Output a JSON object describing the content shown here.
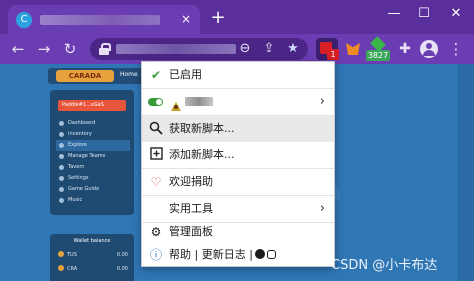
{
  "browser": {
    "tab": {
      "favicon": "C",
      "close": "×"
    },
    "new_tab": "+",
    "window_controls": {
      "minimize": "—",
      "maximize": "☐",
      "close": "✕"
    },
    "nav": {
      "back": "←",
      "forward": "→",
      "reload": "↻"
    },
    "address_icons": {
      "zoom": "⊖",
      "share": "⇪",
      "star": "★"
    },
    "extensions": {
      "tampermonkey_badge": "1",
      "gem_count": "3827",
      "puzzle": "✚"
    },
    "menu_icon": "⋮"
  },
  "page": {
    "logo": "CARADA",
    "home_label": "Home",
    "user_label": "Paddle#1...xGaS",
    "menu": [
      "Dashboard",
      "Inventory",
      "Explore",
      "Manage Teams",
      "Tavern",
      "Settings",
      "Game Guide",
      "Music"
    ],
    "active_menu_index": 2,
    "wallet": {
      "title": "Wallet balance",
      "rows": [
        {
          "coin": "TUS",
          "amount": "0.00"
        },
        {
          "coin": "CRA",
          "amount": "0.00"
        }
      ]
    }
  },
  "popup_menu": {
    "enabled": "已启用",
    "script_name_prefix": "",
    "find_scripts": "获取新脚本...",
    "add_script": "添加新脚本...",
    "donate": "欢迎捐助",
    "utilities": "实用工具",
    "dashboard": "管理面板",
    "footer": "帮助 | 更新日志 |",
    "submenu_arrow": "›",
    "icons": {
      "enabled": "✔",
      "find": "🔍",
      "add": "⊞",
      "donate": "♡",
      "dashboard": "⚙",
      "help": "ⓘ"
    }
  },
  "watermark": "CSDN @小卡布达"
}
